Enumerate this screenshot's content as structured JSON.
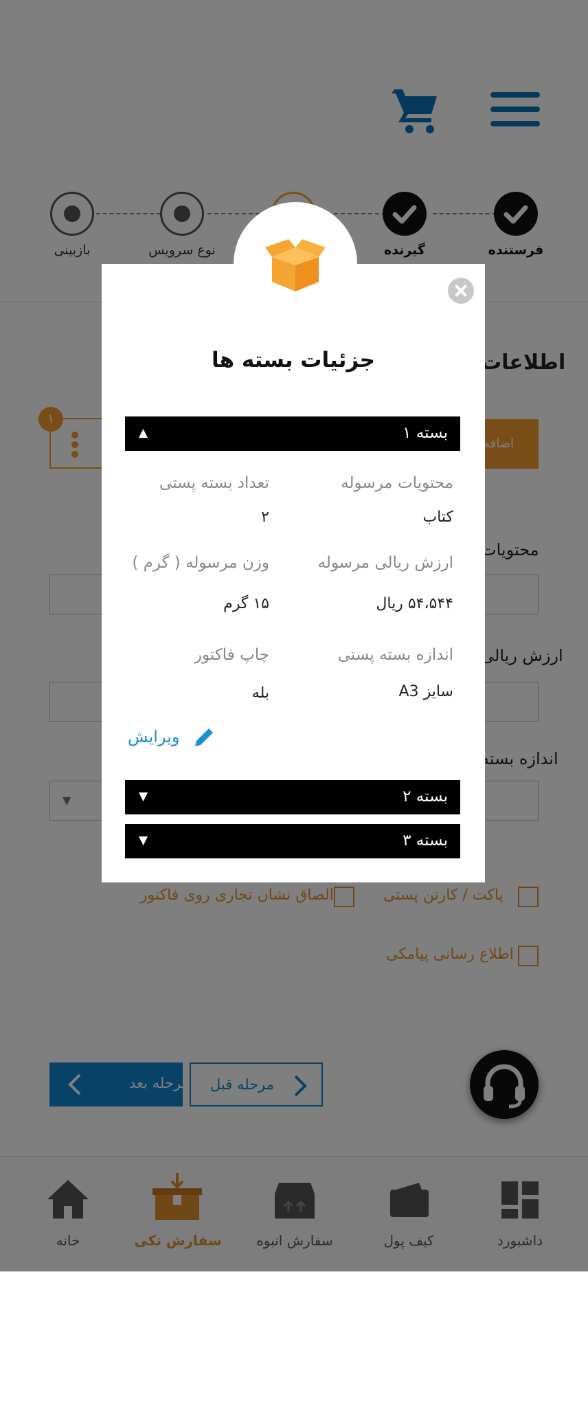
{
  "stepper": {
    "steps": [
      {
        "label": "فرستنده",
        "state": "done"
      },
      {
        "label": "گیرنده",
        "state": "done"
      },
      {
        "label": "",
        "state": "current"
      },
      {
        "label": "نوع سرویس",
        "state": "pending"
      },
      {
        "label": "بازبینی",
        "state": "pending"
      }
    ]
  },
  "form": {
    "section_title": "اطلاعات",
    "add_button": "اضافه",
    "package_badge": "۱",
    "field_contents": "محتویات",
    "field_value": "ارزش ریالی",
    "field_size": "اندازه بسته",
    "check_pack": "پاکت / کارتن پستی",
    "check_logo": "الصاق نشان تجاری روی فاکتور",
    "check_sms": "اطلاع رسانی پیامکی"
  },
  "buttons": {
    "next": "مرحله بعد",
    "prev": "مرحله قبل"
  },
  "bottom_nav": [
    {
      "label": "داشبورد",
      "icon": "dashboard-icon",
      "active": false
    },
    {
      "label": "کیف پول",
      "icon": "wallet-icon",
      "active": false
    },
    {
      "label": "سفارش انبوه",
      "icon": "bulk-order-icon",
      "active": false
    },
    {
      "label": "سفارش تکی",
      "icon": "single-order-icon",
      "active": true
    },
    {
      "label": "خانه",
      "icon": "home-icon",
      "active": false
    }
  ],
  "modal": {
    "title": "جزئیات بسته ها",
    "package1": {
      "header": "بسته ۱",
      "expanded": true,
      "contents_label": "محتویات مرسوله",
      "contents_value": "کتاب",
      "count_label": "تعداد بسته پستی",
      "count_value": "۲",
      "value_label": "ارزش ریالی مرسوله",
      "value_value": "۵۴،۵۴۴ ریال",
      "weight_label": "وزن مرسوله ( گرم )",
      "weight_value": "۱۵ گرم",
      "size_label": "اندازه بسته پستی",
      "size_value": "سایز  A3",
      "invoice_label": "چاپ فاکتور",
      "invoice_value": "بله",
      "edit_label": "ویرایش"
    },
    "package2": {
      "header": "بسته ۲",
      "expanded": false
    },
    "package3": {
      "header": "بسته ۳",
      "expanded": false
    }
  },
  "colors": {
    "brand_blue": "#1185cf",
    "accent_orange": "#f29a2e",
    "overlay": "rgba(0,0,0,0.5)"
  }
}
